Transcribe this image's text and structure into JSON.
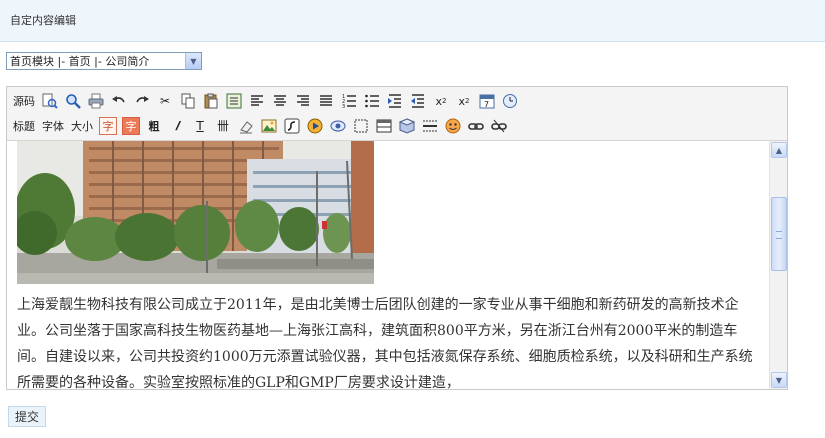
{
  "page": {
    "title": "自定内容编辑"
  },
  "module_select": {
    "selected": "首页模块 |- 首页 |- 公司简介"
  },
  "toolbar": {
    "row1": [
      {
        "name": "source-button",
        "label": "源码",
        "type": "text"
      },
      {
        "name": "preview-icon",
        "type": "icon"
      },
      {
        "name": "find-icon",
        "type": "icon"
      },
      {
        "name": "print-icon",
        "type": "icon"
      },
      {
        "name": "undo-icon",
        "type": "icon"
      },
      {
        "name": "redo-icon",
        "type": "icon"
      },
      {
        "name": "cut-icon",
        "type": "icon"
      },
      {
        "name": "copy-icon",
        "type": "icon"
      },
      {
        "name": "paste-icon",
        "type": "icon"
      },
      {
        "name": "select-all-icon",
        "type": "icon"
      },
      {
        "name": "align-left-icon",
        "type": "icon"
      },
      {
        "name": "align-center-icon",
        "type": "icon"
      },
      {
        "name": "align-right-icon",
        "type": "icon"
      },
      {
        "name": "justify-icon",
        "type": "icon"
      },
      {
        "name": "ordered-list-icon",
        "type": "icon"
      },
      {
        "name": "unordered-list-icon",
        "type": "icon"
      },
      {
        "name": "indent-icon",
        "type": "icon"
      },
      {
        "name": "outdent-icon",
        "type": "icon"
      },
      {
        "name": "subscript-icon",
        "type": "icon"
      },
      {
        "name": "superscript-icon",
        "type": "icon"
      },
      {
        "name": "date-icon",
        "type": "icon"
      },
      {
        "name": "time-icon",
        "type": "icon"
      }
    ],
    "row2_text": {
      "heading": "标题",
      "font": "字体",
      "size": "大小",
      "text_color_glyph": "字",
      "bg_color_glyph": "字",
      "bold_glyph": "粗"
    }
  },
  "content": {
    "paragraph": "上海爱靓生物科技有限公司成立于2011年，是由北美博士后团队创建的一家专业从事干细胞和新药研发的高新技术企业。公司坐落于国家高科技生物医药基地—上海张江高科，建筑面积800平方米，另在浙江台州有2000平米的制造车间。自建设以来，公司共投资约1000万元添置试验仪器，其中包括液氮保存系统、细胞质检系统，以及科研和生产系统所需要的各种设备。实验室按照标准的GLP和GMP厂房要求设计建造，"
  },
  "scroll": {
    "position": 0.22
  },
  "submit": {
    "label": "提交"
  }
}
